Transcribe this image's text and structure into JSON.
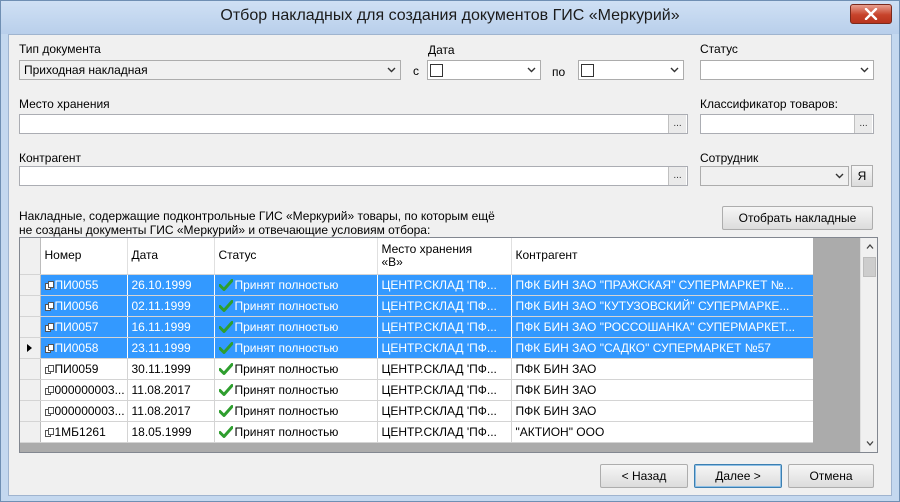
{
  "window": {
    "title": "Отбор накладных для создания документов ГИС «Меркурий»"
  },
  "filters": {
    "doc_type_label": "Тип документа",
    "doc_type_value": "Приходная накладная",
    "date_label": "Дата",
    "date_from_label": "с",
    "date_to_label": "по",
    "status_label": "Статус",
    "status_value": "",
    "storage_label": "Место хранения",
    "classifier_label": "Классификатор товаров:",
    "counterparty_label": "Контрагент",
    "employee_label": "Сотрудник",
    "employee_me_button": "Я",
    "dots_button": "..."
  },
  "hint": {
    "line1": "Накладные, содержащие подконтрольные ГИС «Меркурий» товары, по которым ещё",
    "line2": "не созданы документы ГИС «Меркурий» и отвечающие условиям отбора:"
  },
  "select_button": "Отобрать накладные",
  "table": {
    "columns": [
      "Номер",
      "Дата",
      "Статус",
      "Место хранения «В»",
      "Контрагент"
    ],
    "column_storage_line1": "Место хранения",
    "column_storage_line2": "«В»",
    "rows": [
      {
        "number": "ПИ0055",
        "date": "26.10.1999",
        "status": "Принят полностью",
        "storage": "ЦЕНТР.СКЛАД 'ПФ...",
        "counterparty": "ПФК БИН ЗАО \"ПРАЖСКАЯ\" СУПЕРМАРКЕТ №...",
        "selected": true,
        "current": false
      },
      {
        "number": "ПИ0056",
        "date": "02.11.1999",
        "status": "Принят полностью",
        "storage": "ЦЕНТР.СКЛАД 'ПФ...",
        "counterparty": "ПФК БИН ЗАО \"КУТУЗОВСКИЙ\" СУПЕРМАРКЕ...",
        "selected": true,
        "current": false
      },
      {
        "number": "ПИ0057",
        "date": "16.11.1999",
        "status": "Принят полностью",
        "storage": "ЦЕНТР.СКЛАД 'ПФ...",
        "counterparty": "ПФК БИН ЗАО \"РОССОШАНКА\" СУПЕРМАРКЕТ...",
        "selected": true,
        "current": false
      },
      {
        "number": "ПИ0058",
        "date": "23.11.1999",
        "status": "Принят полностью",
        "storage": "ЦЕНТР.СКЛАД 'ПФ...",
        "counterparty": "ПФК БИН ЗАО \"САДКО\" СУПЕРМАРКЕТ №57",
        "selected": true,
        "current": true
      },
      {
        "number": "ПИ0059",
        "date": "30.11.1999",
        "status": "Принят полностью",
        "storage": "ЦЕНТР.СКЛАД 'ПФ...",
        "counterparty": "ПФК БИН ЗАО",
        "selected": false,
        "current": false
      },
      {
        "number": "000000003...",
        "date": "11.08.2017",
        "status": "Принят полностью",
        "storage": "ЦЕНТР.СКЛАД 'ПФ...",
        "counterparty": "ПФК БИН ЗАО",
        "selected": false,
        "current": false
      },
      {
        "number": "000000003...",
        "date": "11.08.2017",
        "status": "Принят полностью",
        "storage": "ЦЕНТР.СКЛАД 'ПФ...",
        "counterparty": "ПФК БИН ЗАО",
        "selected": false,
        "current": false
      },
      {
        "number": "1МБ1261",
        "date": "18.05.1999",
        "status": "Принят полностью",
        "storage": "ЦЕНТР.СКЛАД 'ПФ...",
        "counterparty": "\"АКТИОН\" ООО",
        "selected": false,
        "current": false
      }
    ]
  },
  "footer": {
    "back_button": "< Назад",
    "next_button": "Далее >",
    "cancel_button": "Отмена"
  },
  "colors": {
    "selection": "#3399ff",
    "window_frame": "#c4d8ef",
    "close_button": "#c7432b"
  }
}
